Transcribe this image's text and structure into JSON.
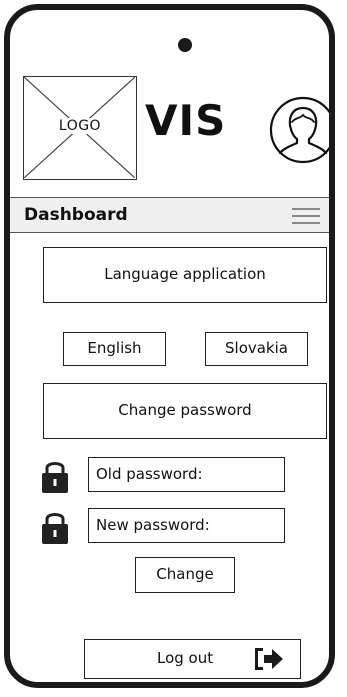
{
  "header": {
    "logo_text": "LOGO",
    "app_title": "VIS"
  },
  "dashboard": {
    "title": "Dashboard"
  },
  "main": {
    "language_heading": "Language application",
    "lang_english": "English",
    "lang_slovakia": "Slovakia",
    "password_heading": "Change password",
    "old_password_label": "Old password:",
    "new_password_label": "New password:",
    "change_button": "Change",
    "logout_button": "Log out"
  },
  "icons": {
    "avatar": "user-avatar-icon",
    "menu": "hamburger-menu-icon",
    "lock": "lock-icon",
    "logout": "logout-arrow-icon"
  }
}
